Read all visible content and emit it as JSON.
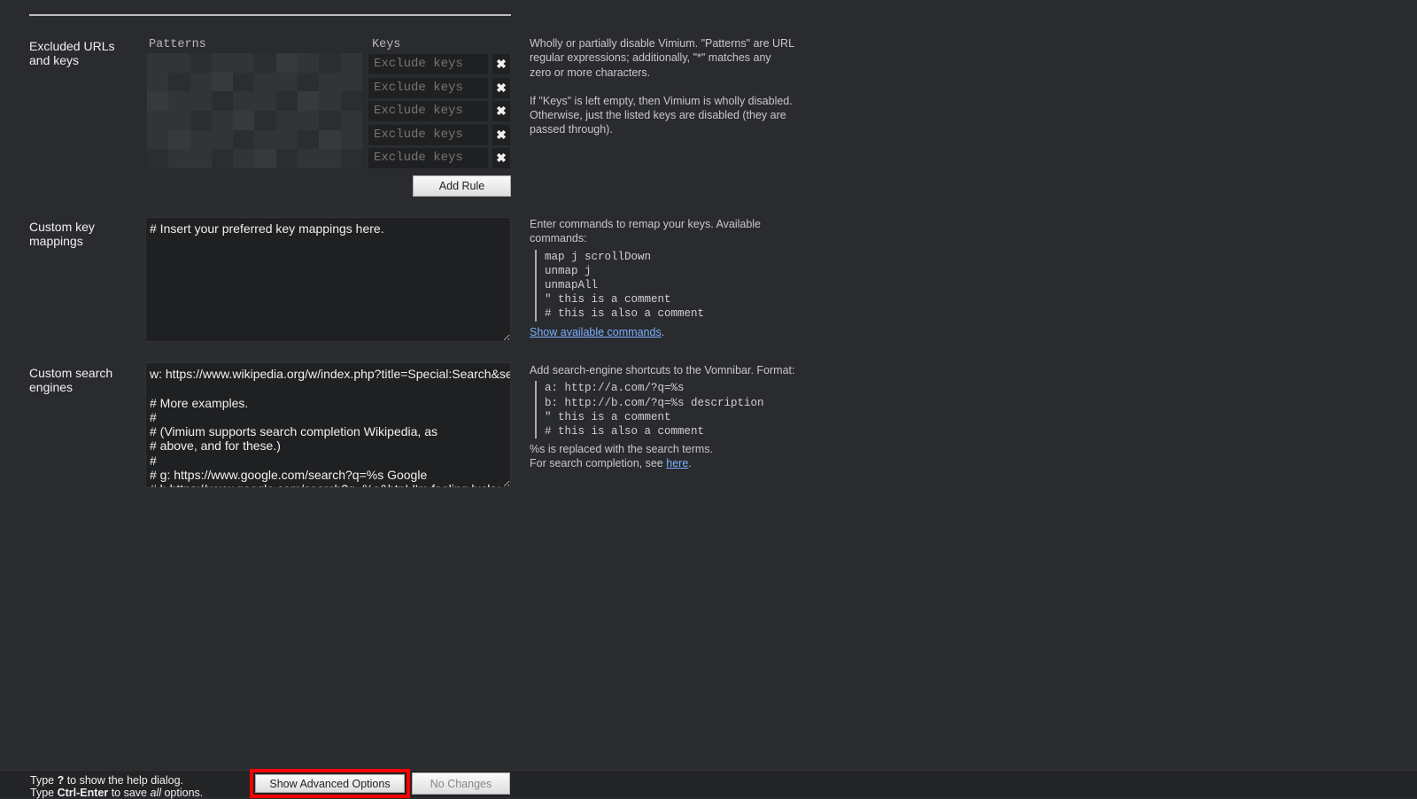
{
  "exclusions": {
    "label": "Excluded URLs and keys",
    "patterns_header": "Patterns",
    "keys_header": "Keys",
    "rows": [
      {
        "keys_placeholder": "Exclude keys"
      },
      {
        "keys_placeholder": "Exclude keys"
      },
      {
        "keys_placeholder": "Exclude keys"
      },
      {
        "keys_placeholder": "Exclude keys"
      },
      {
        "keys_placeholder": "Exclude keys"
      }
    ],
    "remove_icon": "✖",
    "add_rule": "Add Rule",
    "help_1": "Wholly or partially disable Vimium. \"Patterns\" are URL regular expressions; additionally, \"*\" matches any zero or more characters.",
    "help_2": "If \"Keys\" is left empty, then Vimium is wholly disabled. Otherwise, just the listed keys are disabled (they are passed through)."
  },
  "key_mappings": {
    "label": "Custom key mappings",
    "value": "# Insert your preferred key mappings here.",
    "help": "Enter commands to remap your keys. Available commands:",
    "code": "map j scrollDown\nunmap j\nunmapAll\n\" this is a comment\n# this is also a comment",
    "link": "Show available commands",
    "link_suffix": "."
  },
  "search_engines": {
    "label": "Custom search engines",
    "value": "w: https://www.wikipedia.org/w/index.php?title=Special:Search&search=%s Wikipedia\n\n# More examples.\n#\n# (Vimium supports search completion Wikipedia, as\n# above, and for these.)\n#\n# g: https://www.google.com/search?q=%s Google\n# l: https://www.google.com/search?q=%s&btnI I'm feeling lucky...",
    "help": "Add search-engine shortcuts to the Vomnibar. Format:",
    "code": "a: http://a.com/?q=%s\nb: http://b.com/?q=%s description\n\" this is a comment\n# this is also a comment",
    "note_1": "%s is replaced with the search terms.",
    "note_2": "For search completion, see ",
    "link": "here",
    "link_suffix": "."
  },
  "footer": {
    "line1_a": "Type ",
    "line1_key": "?",
    "line1_b": " to show the help dialog.",
    "line2_a": "Type ",
    "line2_key": "Ctrl-Enter",
    "line2_b": " to save ",
    "line2_em": "all",
    "line2_c": " options.",
    "advanced": "Show Advanced Options",
    "save": "No Changes",
    "highlight_color": "#ff0000"
  }
}
